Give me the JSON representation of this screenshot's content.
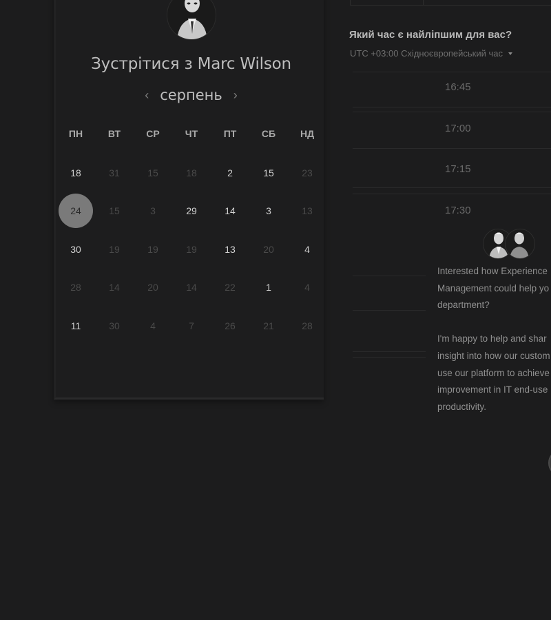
{
  "host": {
    "title": "Зустрітися з Marc Wilson"
  },
  "calendar": {
    "month": "серпень",
    "prev": "‹",
    "next": "›",
    "weekdays": [
      "ПН",
      "ВТ",
      "СР",
      "ЧТ",
      "ПТ",
      "СБ",
      "НД"
    ],
    "weeks": [
      [
        {
          "d": "18",
          "a": true
        },
        {
          "d": "31",
          "a": false
        },
        {
          "d": "15",
          "a": false
        },
        {
          "d": "18",
          "a": false
        },
        {
          "d": "2",
          "a": true
        },
        {
          "d": "15",
          "a": true
        },
        {
          "d": "23",
          "a": false
        }
      ],
      [
        {
          "d": "24",
          "a": true,
          "s": true
        },
        {
          "d": "15",
          "a": false
        },
        {
          "d": "3",
          "a": false
        },
        {
          "d": "29",
          "a": true
        },
        {
          "d": "14",
          "a": true
        },
        {
          "d": "3",
          "a": true
        },
        {
          "d": "13",
          "a": false
        }
      ],
      [
        {
          "d": "30",
          "a": true
        },
        {
          "d": "19",
          "a": false
        },
        {
          "d": "19",
          "a": false
        },
        {
          "d": "19",
          "a": false
        },
        {
          "d": "13",
          "a": true
        },
        {
          "d": "20",
          "a": false
        },
        {
          "d": "4",
          "a": true
        }
      ],
      [
        {
          "d": "28",
          "a": false
        },
        {
          "d": "14",
          "a": false
        },
        {
          "d": "20",
          "a": false
        },
        {
          "d": "14",
          "a": false
        },
        {
          "d": "22",
          "a": false
        },
        {
          "d": "1",
          "a": true
        },
        {
          "d": "4",
          "a": false
        }
      ],
      [
        {
          "d": "11",
          "a": true
        },
        {
          "d": "30",
          "a": false
        },
        {
          "d": "4",
          "a": false
        },
        {
          "d": "7",
          "a": false
        },
        {
          "d": "26",
          "a": false
        },
        {
          "d": "21",
          "a": false
        },
        {
          "d": "28",
          "a": false
        }
      ]
    ]
  },
  "times": {
    "question": "Який час є найліпшим для вас?",
    "timezone": "UTC +03:00 Східноєвропейський час",
    "slots": [
      "16:45",
      "17:00",
      "17:15",
      "17:30"
    ]
  },
  "chat": {
    "message": "Interested how Experience\nManagement could help yo\ndepartment?\n\nI'm happy to help and shar\ninsight into how our custom\nuse our platform to achieve\nimprovement in IT end-use\nproductivity."
  }
}
